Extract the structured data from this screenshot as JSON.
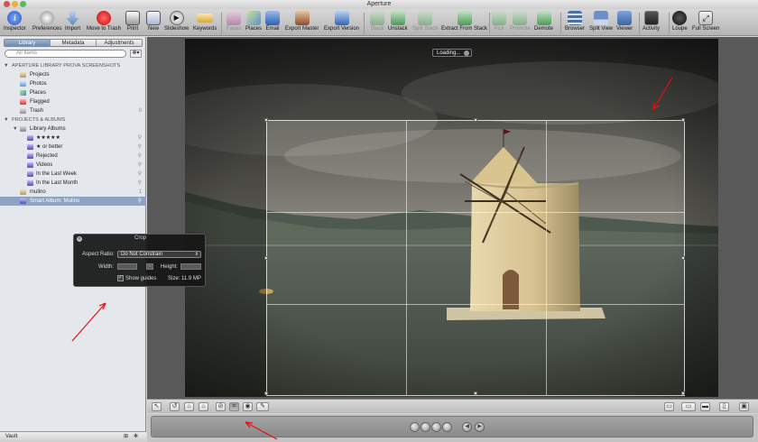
{
  "window": {
    "title": "Aperture"
  },
  "toolbar": {
    "items": [
      {
        "label": "Inspector",
        "icon": "inspector-icon",
        "enabled": true
      },
      {
        "label": "Preferences",
        "icon": "preferences-icon",
        "enabled": true
      },
      {
        "label": "Import",
        "icon": "import-icon",
        "enabled": true
      },
      {
        "label": "Move to Trash",
        "icon": "trash-icon",
        "enabled": true
      },
      {
        "label": "Print",
        "icon": "print-icon",
        "enabled": true
      },
      {
        "label": "New",
        "icon": "new-icon",
        "enabled": true
      },
      {
        "label": "Slideshow",
        "icon": "slideshow-icon",
        "enabled": true
      },
      {
        "label": "Keywords",
        "icon": "keywords-icon",
        "enabled": true
      },
      {
        "label": "Faces",
        "icon": "faces-icon",
        "enabled": false
      },
      {
        "label": "Places",
        "icon": "places-icon",
        "enabled": true
      },
      {
        "label": "Email",
        "icon": "email-icon",
        "enabled": true
      },
      {
        "label": "Export Master",
        "icon": "export-master-icon",
        "enabled": true
      },
      {
        "label": "Export Version",
        "icon": "export-version-icon",
        "enabled": true
      },
      {
        "label": "Stack",
        "icon": "stack-icon",
        "enabled": false
      },
      {
        "label": "Unstack",
        "icon": "unstack-icon",
        "enabled": true
      },
      {
        "label": "Split Stack",
        "icon": "split-stack-icon",
        "enabled": false
      },
      {
        "label": "Extract From Stack",
        "icon": "extract-icon",
        "enabled": true
      },
      {
        "label": "Pick",
        "icon": "pick-icon",
        "enabled": false
      },
      {
        "label": "Promote",
        "icon": "promote-icon",
        "enabled": false
      },
      {
        "label": "Demote",
        "icon": "demote-icon",
        "enabled": true
      },
      {
        "label": "Browser",
        "icon": "browser-icon",
        "enabled": true
      },
      {
        "label": "Split View",
        "icon": "split-view-icon",
        "enabled": true
      },
      {
        "label": "Viewer",
        "icon": "viewer-icon",
        "enabled": true
      },
      {
        "label": "Activity",
        "icon": "activity-icon",
        "enabled": true
      },
      {
        "label": "Loupe",
        "icon": "loupe-icon",
        "enabled": true
      },
      {
        "label": "Full Screen",
        "icon": "full-screen-icon",
        "enabled": true
      }
    ]
  },
  "sidebar": {
    "tabs": [
      {
        "label": "Library",
        "active": true
      },
      {
        "label": "Metadata",
        "active": false
      },
      {
        "label": "Adjustments",
        "active": false
      }
    ],
    "search_placeholder": "All Items",
    "section_library": "APERTURE LIBRARY PROVA SCREENSHOTS",
    "library_items": [
      {
        "label": "Projects",
        "count": ""
      },
      {
        "label": "Photos",
        "count": ""
      },
      {
        "label": "Places",
        "count": ""
      },
      {
        "label": "Flagged",
        "count": ""
      },
      {
        "label": "Trash",
        "count": "0"
      }
    ],
    "section_projects": "PROJECTS & ALBUMS",
    "library_albums_label": "Library Albums",
    "albums": [
      {
        "label": "★★★★★"
      },
      {
        "label": "★ or better"
      },
      {
        "label": "Rejected"
      },
      {
        "label": "Videos"
      },
      {
        "label": "In the Last Week"
      },
      {
        "label": "In the Last Month"
      }
    ],
    "project": {
      "label": "mulino",
      "count": "1"
    },
    "smart_album": {
      "label": "Smart Album: Mulino"
    },
    "vault_label": "Vault"
  },
  "viewer": {
    "loading_label": "Loading..."
  },
  "crop_hud": {
    "title": "Crop",
    "aspect_label": "Aspect Ratio:",
    "aspect_value": "Do Not Constrain",
    "width_label": "Width:",
    "height_label": "Height:",
    "show_guides_label": "Show guides",
    "show_guides_checked": true,
    "size_label": "Size: 11.9 MP"
  },
  "colors": {
    "sidebar_selection": "#8da3c3",
    "annotation_arrow": "#e01010"
  }
}
